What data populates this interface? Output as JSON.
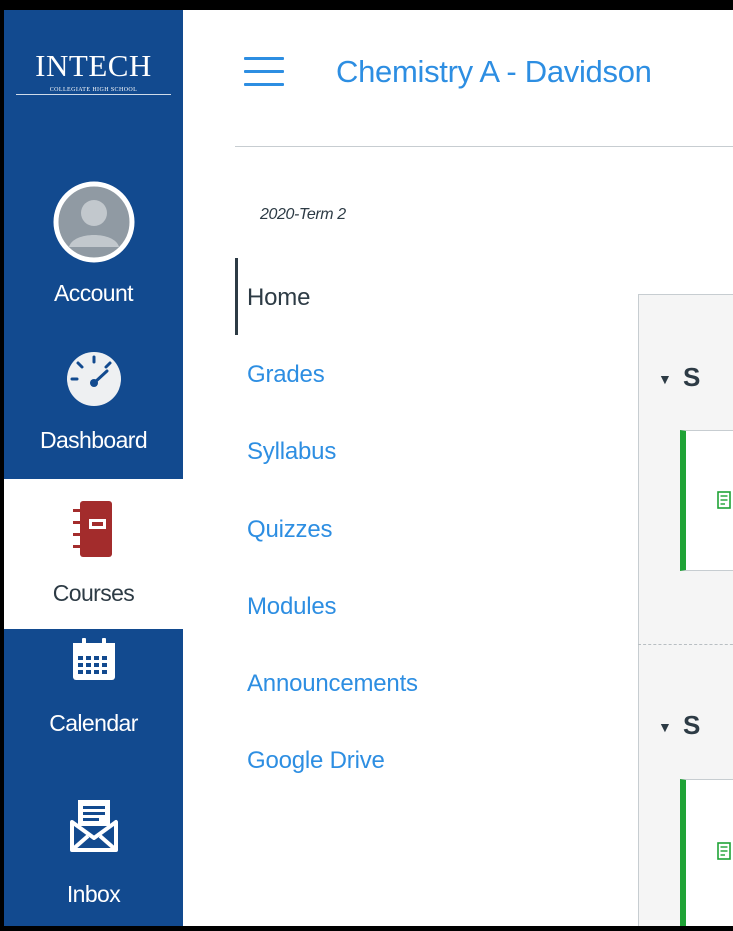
{
  "logo": {
    "main": "INTECH",
    "sub": "COLLEGIATE HIGH SCHOOL"
  },
  "global_nav": [
    {
      "label": "Account",
      "icon": "account-avatar-icon"
    },
    {
      "label": "Dashboard",
      "icon": "dashboard-gauge-icon"
    },
    {
      "label": "Courses",
      "icon": "courses-book-icon",
      "active": true
    },
    {
      "label": "Calendar",
      "icon": "calendar-icon"
    },
    {
      "label": "Inbox",
      "icon": "inbox-envelope-icon"
    }
  ],
  "course": {
    "title": "Chemistry A - Davidson",
    "term": "2020-Term 2"
  },
  "course_nav": [
    {
      "label": "Home",
      "active": true
    },
    {
      "label": "Grades"
    },
    {
      "label": "Syllabus"
    },
    {
      "label": "Quizzes"
    },
    {
      "label": "Modules"
    },
    {
      "label": "Announcements"
    },
    {
      "label": "Google Drive"
    }
  ],
  "modules": [
    {
      "toggle": "▼",
      "letter": "S"
    },
    {
      "toggle": "▼",
      "letter": "S"
    }
  ],
  "colors": {
    "nav_bg": "#124a8f",
    "link_blue": "#2d8ee2",
    "text_dark": "#2d3b45",
    "published_green": "#1fa336",
    "courses_icon_red": "#a32c2c"
  }
}
